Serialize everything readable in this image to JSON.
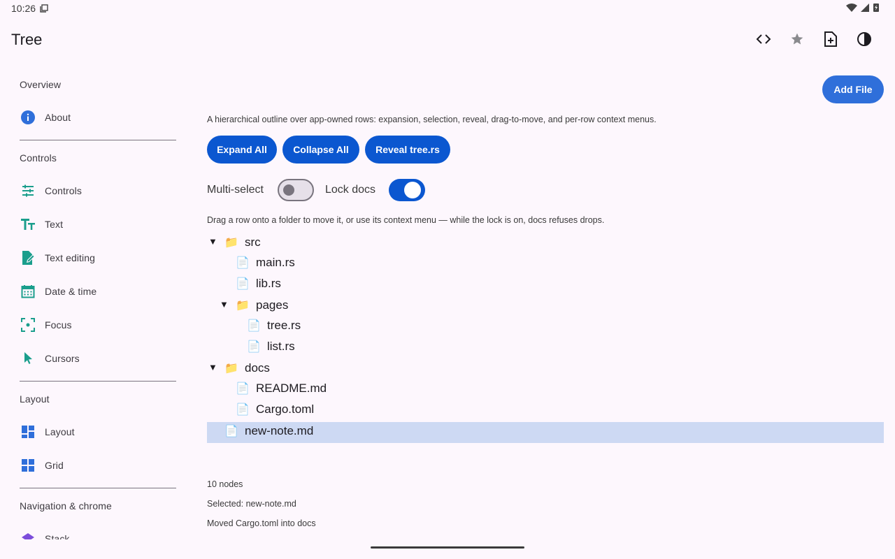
{
  "status_bar": {
    "time": "10:26"
  },
  "app_bar": {
    "title": "Tree",
    "actions": [
      {
        "name": "code-icon"
      },
      {
        "name": "star-icon"
      },
      {
        "name": "add-file-icon"
      },
      {
        "name": "theme-contrast-icon"
      }
    ]
  },
  "sidebar": {
    "sections": [
      {
        "title": "Overview"
      },
      {
        "title": "Controls"
      },
      {
        "title": "Layout"
      },
      {
        "title": "Navigation & chrome"
      }
    ],
    "items": [
      {
        "label": "About",
        "icon": "info-icon"
      },
      {
        "label": "Controls",
        "icon": "tune-icon"
      },
      {
        "label": "Text",
        "icon": "text-icon"
      },
      {
        "label": "Text editing",
        "icon": "edit-document-icon"
      },
      {
        "label": "Date & time",
        "icon": "calendar-icon"
      },
      {
        "label": "Focus",
        "icon": "focus-icon"
      },
      {
        "label": "Cursors",
        "icon": "cursor-icon"
      },
      {
        "label": "Layout",
        "icon": "layout-icon"
      },
      {
        "label": "Grid",
        "icon": "grid-icon"
      },
      {
        "label": "Stack",
        "icon": "stack-icon"
      }
    ]
  },
  "main": {
    "add_file_label": "Add File",
    "description": "A hierarchical outline over app-owned rows: expansion, selection, reveal, drag-to-move, and per-row context menus.",
    "buttons": {
      "expand_all": "Expand All",
      "collapse_all": "Collapse All",
      "reveal": "Reveal tree.rs"
    },
    "toggles": {
      "multi_select": "Multi-select",
      "lock_docs": "Lock docs",
      "multi_select_on": false,
      "lock_docs_on": true
    },
    "hint": "Drag a row onto a folder to move it, or use its context menu — while the lock is on, docs refuses drops.",
    "tree": [
      {
        "label": "src",
        "type": "folder",
        "depth": 0,
        "expanded": true
      },
      {
        "label": "main.rs",
        "type": "file",
        "depth": 1
      },
      {
        "label": "lib.rs",
        "type": "file",
        "depth": 1
      },
      {
        "label": "pages",
        "type": "folder",
        "depth": 1,
        "expanded": true
      },
      {
        "label": "tree.rs",
        "type": "file",
        "depth": 2
      },
      {
        "label": "list.rs",
        "type": "file",
        "depth": 2
      },
      {
        "label": "docs",
        "type": "folder",
        "depth": 0,
        "expanded": true
      },
      {
        "label": "README.md",
        "type": "file",
        "depth": 1
      },
      {
        "label": "Cargo.toml",
        "type": "file",
        "depth": 1
      },
      {
        "label": "new-note.md",
        "type": "file",
        "depth": 0,
        "selected": true
      }
    ],
    "status": {
      "nodes": "10 nodes",
      "selected": "Selected: new-note.md",
      "moved": "Moved Cargo.toml into docs"
    }
  },
  "colors": {
    "accent": "#0b57d0",
    "selected_row": "#cdd9f3",
    "background": "#fdf7fd"
  }
}
